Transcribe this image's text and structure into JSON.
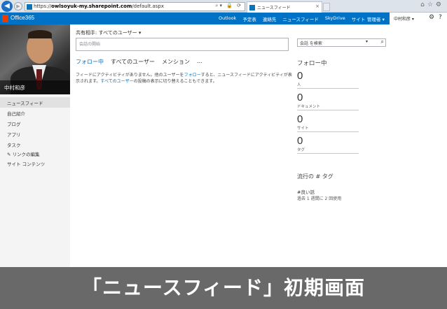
{
  "browser": {
    "url_prefix": "https://",
    "url_host": "owlsoyuk-my.sharepoint.com",
    "url_path": "/default.aspx",
    "tab_title": "ニュースフィード",
    "tab_close": "×"
  },
  "suite": {
    "brand": "Office365",
    "nav": [
      "Outlook",
      "予定表",
      "連絡先",
      "ニュースフィード",
      "SkyDrive",
      "サイト",
      "…"
    ],
    "admin": "管理者 ▾",
    "user_name": "中村和彦 ▾",
    "gear_icon": "gear-icon",
    "help_icon": "help-icon"
  },
  "profile": {
    "name": "中村和彦"
  },
  "left_nav": {
    "items": [
      "ニュースフィード",
      "自己紹介",
      "ブログ",
      "アプリ",
      "タスク"
    ],
    "links_label": "リンクの編集",
    "site_contents": "サイト コンテンツ"
  },
  "main": {
    "share_label": "共有相手: すべてのユーザー ▾",
    "share_placeholder": "会話の開始",
    "tabs": [
      "フォロー中",
      "すべてのユーザー",
      "メンション",
      "…"
    ],
    "empty_1": "フィードにアクティビティがありません。他のユーザーを",
    "empty_link1": "フォロー",
    "empty_2": "すると、ニュースフィードにアクティビティが表示されます。",
    "empty_link2": "すべてのユーザー",
    "empty_3": "の投稿の表示に切り替えることもできます。"
  },
  "right": {
    "search_placeholder": "会話 を検索",
    "search_chevron": "▾",
    "follow_title": "フォロー中",
    "stats": [
      {
        "value": "0",
        "label": "人"
      },
      {
        "value": "0",
        "label": "ドキュメント"
      },
      {
        "value": "0",
        "label": "サイト"
      },
      {
        "value": "0",
        "label": "タグ"
      }
    ],
    "trend_title": "流行の # タグ",
    "trend_tag": "#良い話",
    "trend_note": "過去 1 週間に 2 回使用"
  },
  "caption": "「ニュースフィード」初期画面",
  "colors": {
    "suite_bar": "#0072c6",
    "link": "#0072c6",
    "caption_bg": "#696969"
  }
}
